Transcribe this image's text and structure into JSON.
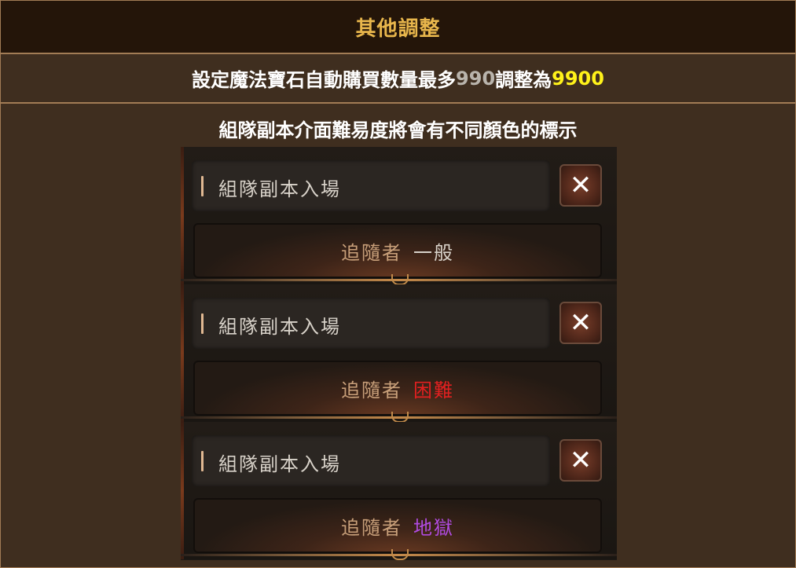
{
  "header": {
    "title": "其他調整"
  },
  "row1": {
    "prefix": "設定魔法寶石自動購買數量最多",
    "old_value": "990",
    "middle": "調整為",
    "new_value": "9900"
  },
  "row2": {
    "heading": "組隊副本介面難易度將會有不同顏色的標示"
  },
  "panels": [
    {
      "title": "組隊副本入場",
      "close_symbol": "✕",
      "follower_label": "追隨者",
      "difficulty": "一般",
      "difficulty_color": "#d8d2c9"
    },
    {
      "title": "組隊副本入場",
      "close_symbol": "✕",
      "follower_label": "追隨者",
      "difficulty": "困難",
      "difficulty_color": "#e02020"
    },
    {
      "title": "組隊副本入場",
      "close_symbol": "✕",
      "follower_label": "追隨者",
      "difficulty": "地獄",
      "difficulty_color": "#b04be0"
    }
  ]
}
